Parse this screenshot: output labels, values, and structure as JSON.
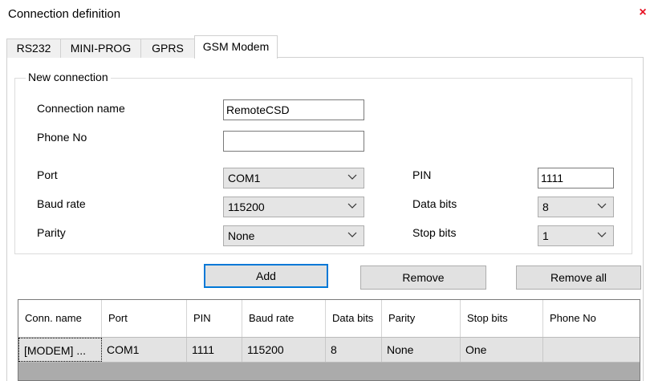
{
  "window": {
    "title": "Connection definition",
    "close_glyph": "×"
  },
  "tabs": [
    {
      "label": "RS232",
      "active": false
    },
    {
      "label": "MINI-PROG",
      "active": false
    },
    {
      "label": "GPRS",
      "active": false
    },
    {
      "label": "GSM Modem",
      "active": true
    }
  ],
  "group": {
    "legend": "New connection",
    "connection_name": {
      "label": "Connection name",
      "value": "RemoteCSD"
    },
    "phone_no": {
      "label": "Phone No",
      "value": ""
    },
    "port": {
      "label": "Port",
      "value": "COM1"
    },
    "baud_rate": {
      "label": "Baud rate",
      "value": "115200"
    },
    "parity": {
      "label": "Parity",
      "value": "None"
    },
    "pin": {
      "label": "PIN",
      "value": "1111"
    },
    "data_bits": {
      "label": "Data bits",
      "value": "8"
    },
    "stop_bits": {
      "label": "Stop bits",
      "value": "1"
    }
  },
  "buttons": {
    "add": "Add",
    "remove": "Remove",
    "remove_all": "Remove all"
  },
  "grid": {
    "columns": [
      "Conn. name",
      "Port",
      "PIN",
      "Baud rate",
      "Data bits",
      "Parity",
      "Stop bits",
      "Phone No"
    ],
    "rows": [
      [
        "[MODEM] ...",
        "COM1",
        "1111",
        "115200",
        "8",
        "None",
        "One",
        ""
      ]
    ]
  },
  "icons": {
    "close": "close-icon",
    "dropdown": "chevron-down-icon"
  },
  "colors": {
    "focus_border": "#0078d7",
    "close": "#e81123",
    "grid_background": "#ababab"
  }
}
